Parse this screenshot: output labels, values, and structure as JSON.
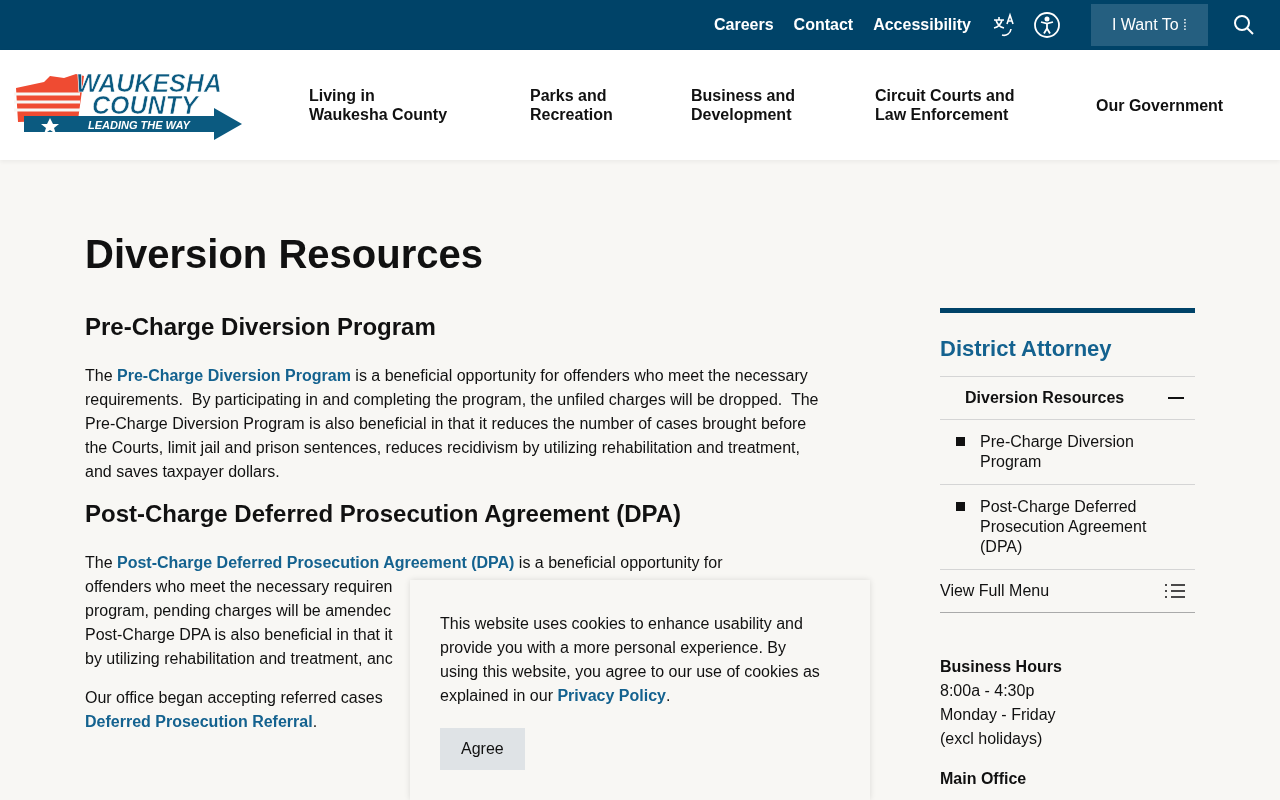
{
  "utility_bar": {
    "links": [
      "Careers",
      "Contact",
      "Accessibility"
    ],
    "i_want_to": {
      "label": "I Want To",
      "caret": "⁞"
    }
  },
  "logo": {
    "line_1": "WAUKESHA",
    "line_2": "COUNTY",
    "tagline": "LEADING THE WAY"
  },
  "main_nav": [
    {
      "lines": [
        "Living in",
        "Waukesha County"
      ]
    },
    {
      "lines": [
        "Parks and",
        "Recreation"
      ]
    },
    {
      "lines": [
        "Business and",
        "Development"
      ]
    },
    {
      "lines": [
        "Circuit Courts and",
        "Law Enforcement"
      ]
    },
    {
      "lines": [
        "Our Government"
      ]
    }
  ],
  "page_title": "Diversion Resources",
  "sections": [
    {
      "heading": "Pre-Charge Diversion Program",
      "paragraphs": [
        {
          "before": "The ",
          "link": "Pre-Charge Diversion Program",
          "after": " is a beneficial opportunity for offenders who meet the necessary requirements.  By participating in and completing the program, the unfiled charges will be dropped.  The Pre-Charge Diversion Program is also beneficial in that it reduces the number of cases brought before the Courts, limit jail and prison sentences, reduces recidivism by utilizing rehabilitation and treatment, and saves taxpayer dollars."
        }
      ]
    },
    {
      "heading": "Post-Charge Deferred Prosecution Agreement (DPA)",
      "paragraphs": [
        {
          "lines": [
            {
              "before": "The ",
              "link": "Post-Charge Deferred Prosecution Agreement (DPA)",
              "after": " is a beneficial opportunity for"
            },
            {
              "before": "offenders who meet the necessary requiren"
            },
            {
              "before": "program, pending charges will be amendec"
            },
            {
              "before": "Post-Charge DPA is also beneficial in that it"
            },
            {
              "before": "by utilizing rehabilitation and treatment, anc"
            }
          ]
        },
        {
          "lines": [
            {
              "before": "Our office began accepting referred cases"
            },
            {
              "link": "Deferred Prosecution Referral",
              "after": "."
            }
          ]
        }
      ]
    }
  ],
  "sidebar": {
    "title": "District Attorney",
    "current": {
      "label": "Diversion Resources",
      "expanded": true
    },
    "items": [
      "Pre-Charge Diversion Program",
      "Post-Charge Deferred Prosecution Agreement (DPA)"
    ],
    "full_menu": "View Full Menu",
    "info": [
      {
        "heading": "Business Hours",
        "lines": [
          "8:00a - 4:30p",
          "Monday - Friday",
          "(excl holidays)"
        ]
      },
      {
        "heading": "Main Office"
      }
    ]
  },
  "cookie_notice": {
    "before": "This website uses cookies to enhance usability and provide you with a more personal experience. By using this website, you agree to our use of cookies as explained in our ",
    "link": "Privacy Policy",
    "after": ".",
    "button": "Agree"
  }
}
